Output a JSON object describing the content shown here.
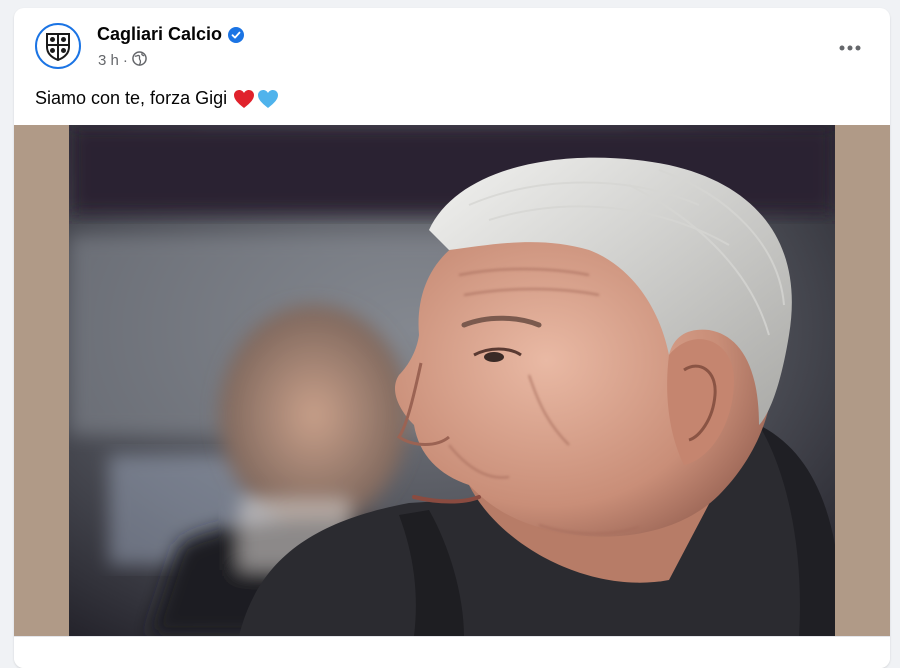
{
  "post": {
    "author": "Cagliari Calcio",
    "time": "3 h",
    "separator": "·",
    "caption": "Siamo con te, forza Gigi",
    "emojis": [
      "red-heart",
      "blue-heart"
    ],
    "verified": true,
    "audience_icon": "globe-icon",
    "photo_description_icon": "photo"
  },
  "colors": {
    "accent": "#1b74e4",
    "photo_border": "#b09a87"
  }
}
